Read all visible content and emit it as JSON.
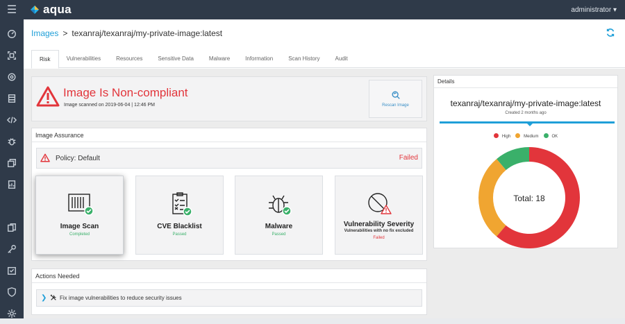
{
  "app": {
    "logo_text": "aqua",
    "user": "administrator ▾"
  },
  "breadcrumb": {
    "root": "Images",
    "separator": ">",
    "current": "texanraj/texanraj/my-private-image:latest"
  },
  "tabs": [
    "Risk",
    "Vulnerabilities",
    "Resources",
    "Sensitive Data",
    "Malware",
    "Information",
    "Scan History",
    "Audit"
  ],
  "banner": {
    "title": "Image Is Non-compliant",
    "subtitle": "Image scanned on 2019-06-04 | 12:46 PM",
    "rescan_label": "Rescan Image"
  },
  "assurance": {
    "header": "Image Assurance",
    "policy_label": "Policy: Default",
    "policy_status": "Failed",
    "cards": [
      {
        "title": "Image Scan",
        "status": "Completed"
      },
      {
        "title": "CVE Blacklist",
        "status": "Passed"
      },
      {
        "title": "Malware",
        "status": "Passed"
      },
      {
        "title": "Vulnerability Severity",
        "desc": "Vulnerabilities with no fix excluded",
        "status": "Failed"
      }
    ]
  },
  "actions": {
    "header": "Actions Needed",
    "items": [
      "Fix image vulnerabilities to reduce security issues"
    ]
  },
  "details": {
    "header": "Details",
    "image_name": "texanraj/texanraj/my-private-image:latest",
    "created": "Created 2 months ago",
    "legend": [
      {
        "label": "High",
        "color": "#e2353b"
      },
      {
        "label": "Medium",
        "color": "#f0a531"
      },
      {
        "label": "OK",
        "color": "#3ab06a"
      }
    ],
    "total_label": "Total: 18"
  },
  "chart_data": {
    "type": "pie",
    "categories": [
      "High",
      "Medium",
      "OK"
    ],
    "values": [
      11,
      5,
      2
    ],
    "colors": [
      "#e2353b",
      "#f0a531",
      "#3ab06a"
    ],
    "center_label": "Total: 18",
    "legend_position": "top"
  }
}
